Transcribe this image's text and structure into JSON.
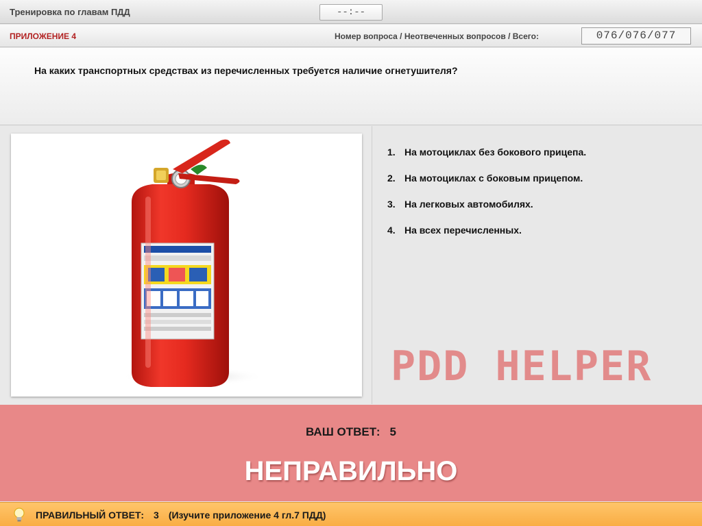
{
  "header": {
    "app_title": "Тренировка по главам ПДД",
    "timer": "--:--"
  },
  "info": {
    "appendix": "ПРИЛОЖЕНИЕ 4",
    "counter_label": "Номер вопроса / Неотвеченных вопросов / Всего:",
    "counter_value": "076/076/077"
  },
  "question": {
    "text": "На каких транспортных средствах из перечисленных требуется наличие огнетушителя?",
    "image_icon": "fire-extinguisher-photo"
  },
  "answers": [
    {
      "num": "1.",
      "text": "На мотоциклах без бокового прицепа."
    },
    {
      "num": "2.",
      "text": "На мотоциклах с боковым прицепом."
    },
    {
      "num": "3.",
      "text": "На легковых автомобилях."
    },
    {
      "num": "4.",
      "text": "На всех перечисленных."
    }
  ],
  "watermark": "PDD HELPER",
  "result": {
    "your_answer_label": "ВАШ  ОТВЕТ:",
    "your_answer_value": "5",
    "verdict": "НЕПРАВИЛЬНО",
    "panel_color": "#e88888"
  },
  "footer": {
    "icon": "lightbulb-icon",
    "correct_label": "ПРАВИЛЬНЫЙ ОТВЕТ:",
    "correct_value": "3",
    "hint": "(Изучите приложение 4 гл.7 ПДД)",
    "bar_color": "#fbb24f"
  }
}
